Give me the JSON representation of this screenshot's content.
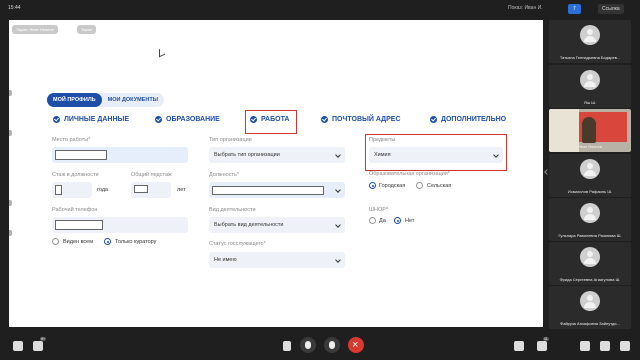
{
  "topbar": {
    "time": "15:44",
    "presenter": "Показ: Иван И.",
    "people_count": "7",
    "link_label": "Ссылка"
  },
  "stage_controls": {
    "chip1": "Экран: Иван Иванов",
    "chip2": "Экран"
  },
  "profile_tabs": [
    "МОЙ ПРОФИЛЬ",
    "МОИ ДОКУМЕНТЫ"
  ],
  "steps": [
    {
      "label": "ЛИЧНЫЕ ДАННЫЕ"
    },
    {
      "label": "ОБРАЗОВАНИЕ"
    },
    {
      "label": "РАБОТА",
      "active": true
    },
    {
      "label": "ПОЧТОВЫЙ АДРЕС"
    },
    {
      "label": "ДОПОЛНИТЕЛЬНО"
    }
  ],
  "form": {
    "workplace_label": "Место работы*",
    "tenure_label": "Стаж в должности",
    "tenure_unit": "года",
    "total_tenure_label": "Общий педстаж",
    "total_unit": "лет",
    "work_phone_label": "Рабочий телефон",
    "visibility": {
      "all": "Виден всем",
      "curator": "Только куратору"
    },
    "org_type_label": "Тип организации",
    "org_type_value": "Выбрать тип организации",
    "position_label": "Должность*",
    "activity_label": "Вид деятельности",
    "activity_value": "Выбрать вид деятельности",
    "civil_status_label": "Статус госслужащего*",
    "civil_status_value": "Не имею",
    "subjects_label": "Предметы",
    "subjects_value": "Химия",
    "edu_org_label": "Образовательная организация*",
    "city": "Городская",
    "village": "Сельская",
    "shnor_label": "ШНОР*",
    "yes": "Да",
    "no": "Нет"
  },
  "accent_color": "#1e4fa8",
  "highlight_color": "#d0342c",
  "participants": [
    {
      "name": "Татьяна Геннадьевна Бодарев...",
      "video": false
    },
    {
      "name": "Яш Ш.",
      "video": false
    },
    {
      "name": "Иван Иванов",
      "video": true
    },
    {
      "name": "Исмагилов Рафаиль Ш.",
      "video": false
    },
    {
      "name": "Гульнара Равилевна Разипова Ш.",
      "video": false
    },
    {
      "name": "Фрида Сергеевна Агиагулова Ш.",
      "video": false
    },
    {
      "name": "Файруза Анзафовна Зайнутди...",
      "video": false
    }
  ],
  "bottom_badges": {
    "left": "9+",
    "right": "11"
  }
}
